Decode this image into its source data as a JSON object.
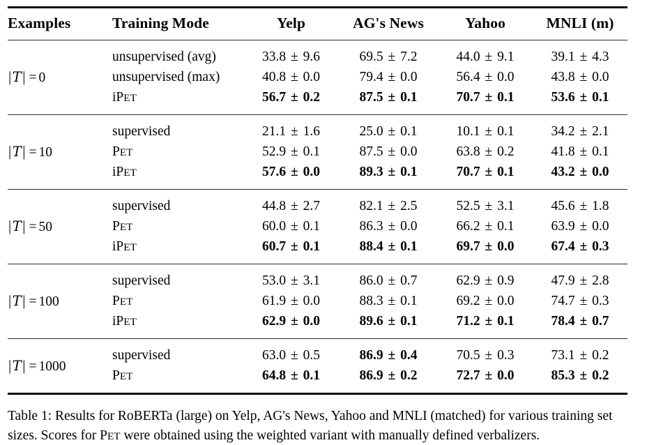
{
  "table": {
    "columns": [
      {
        "key": "examples",
        "label": "Examples",
        "align": "left"
      },
      {
        "key": "mode",
        "label": "Training Mode",
        "align": "left"
      },
      {
        "key": "yelp",
        "label": "Yelp",
        "align": "center"
      },
      {
        "key": "agnews",
        "label": "AG's News",
        "align": "center"
      },
      {
        "key": "yahoo",
        "label": "Yahoo",
        "align": "center"
      },
      {
        "key": "mnli",
        "label": "MNLI (m)",
        "align": "center"
      }
    ],
    "blocks": [
      {
        "examples_label": "|T| = 0",
        "examples_value": "0",
        "rows": [
          {
            "mode": "unsupervised (avg)",
            "mode_bold": false,
            "values": [
              "33.8 ± 9.6",
              "69.5 ± 7.2",
              "44.0 ± 9.1",
              "39.1 ± 4.3"
            ],
            "bold": [
              false,
              false,
              false,
              false
            ]
          },
          {
            "mode": "unsupervised (max)",
            "mode_bold": false,
            "values": [
              "40.8 ± 0.0",
              "79.4 ± 0.0",
              "56.4 ± 0.0",
              "43.8 ± 0.0"
            ],
            "bold": [
              false,
              false,
              false,
              false
            ]
          },
          {
            "mode": "iPET",
            "mode_bold": false,
            "values": [
              "56.7 ± 0.2",
              "87.5 ± 0.1",
              "70.7 ± 0.1",
              "53.6 ± 0.1"
            ],
            "bold": [
              true,
              true,
              true,
              true
            ]
          }
        ]
      },
      {
        "examples_label": "|T| = 10",
        "examples_value": "10",
        "rows": [
          {
            "mode": "supervised",
            "mode_bold": false,
            "values": [
              "21.1 ± 1.6",
              "25.0 ± 0.1",
              "10.1 ± 0.1",
              "34.2 ± 2.1"
            ],
            "bold": [
              false,
              false,
              false,
              false
            ]
          },
          {
            "mode": "PET",
            "mode_bold": false,
            "values": [
              "52.9 ± 0.1",
              "87.5 ± 0.0",
              "63.8 ± 0.2",
              "41.8 ± 0.1"
            ],
            "bold": [
              false,
              false,
              false,
              false
            ]
          },
          {
            "mode": "iPET",
            "mode_bold": false,
            "values": [
              "57.6 ± 0.0",
              "89.3 ± 0.1",
              "70.7 ± 0.1",
              "43.2 ± 0.0"
            ],
            "bold": [
              true,
              true,
              true,
              true
            ]
          }
        ]
      },
      {
        "examples_label": "|T| = 50",
        "examples_value": "50",
        "rows": [
          {
            "mode": "supervised",
            "mode_bold": false,
            "values": [
              "44.8 ± 2.7",
              "82.1 ± 2.5",
              "52.5 ± 3.1",
              "45.6 ± 1.8"
            ],
            "bold": [
              false,
              false,
              false,
              false
            ]
          },
          {
            "mode": "PET",
            "mode_bold": false,
            "values": [
              "60.0 ± 0.1",
              "86.3 ± 0.0",
              "66.2 ± 0.1",
              "63.9 ± 0.0"
            ],
            "bold": [
              false,
              false,
              false,
              false
            ]
          },
          {
            "mode": "iPET",
            "mode_bold": false,
            "values": [
              "60.7 ± 0.1",
              "88.4 ± 0.1",
              "69.7 ± 0.0",
              "67.4 ± 0.3"
            ],
            "bold": [
              true,
              true,
              true,
              true
            ]
          }
        ]
      },
      {
        "examples_label": "|T| = 100",
        "examples_value": "100",
        "rows": [
          {
            "mode": "supervised",
            "mode_bold": false,
            "values": [
              "53.0 ± 3.1",
              "86.0 ± 0.7",
              "62.9 ± 0.9",
              "47.9 ± 2.8"
            ],
            "bold": [
              false,
              false,
              false,
              false
            ]
          },
          {
            "mode": "PET",
            "mode_bold": false,
            "values": [
              "61.9 ± 0.0",
              "88.3 ± 0.1",
              "69.2 ± 0.0",
              "74.7 ± 0.3"
            ],
            "bold": [
              false,
              false,
              false,
              false
            ]
          },
          {
            "mode": "iPET",
            "mode_bold": false,
            "values": [
              "62.9 ± 0.0",
              "89.6 ± 0.1",
              "71.2 ± 0.1",
              "78.4 ± 0.7"
            ],
            "bold": [
              true,
              true,
              true,
              true
            ]
          }
        ]
      },
      {
        "examples_label": "|T| = 1000",
        "examples_value": "1000",
        "rows": [
          {
            "mode": "supervised",
            "mode_bold": false,
            "values": [
              "63.0 ± 0.5",
              "86.9 ± 0.4",
              "70.5 ± 0.3",
              "73.1 ± 0.2"
            ],
            "bold": [
              false,
              true,
              false,
              false
            ]
          },
          {
            "mode": "PET",
            "mode_bold": false,
            "values": [
              "64.8 ± 0.1",
              "86.9 ± 0.2",
              "72.7 ± 0.0",
              "85.3 ± 0.2"
            ],
            "bold": [
              true,
              true,
              true,
              true
            ]
          }
        ]
      }
    ]
  },
  "caption": {
    "label": "Table 1:",
    "text_part1": "Results for RoBERTa (large) on Yelp, AG's News, Yahoo and MNLI (matched) for various training set sizes. Scores for ",
    "acronym": "PET",
    "text_part2": " were obtained using the weighted variant with manually defined verbalizers."
  }
}
